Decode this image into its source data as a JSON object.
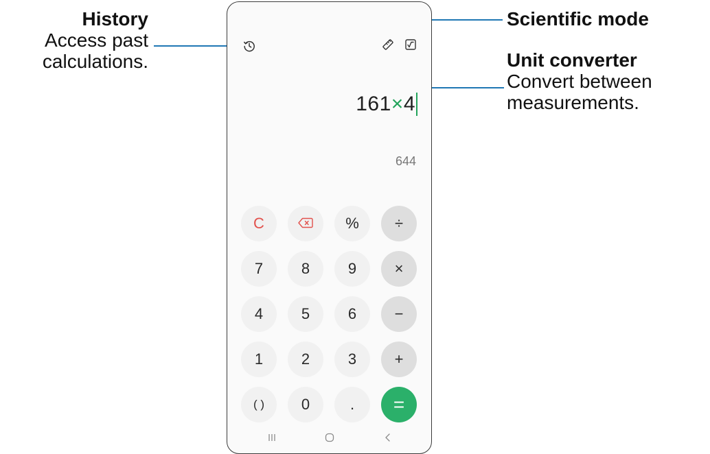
{
  "callouts": {
    "history_title": "History",
    "history_line1": "Access past",
    "history_line2": "calculations.",
    "scientific_title": "Scientific mode",
    "unit_title": "Unit converter",
    "unit_line1": "Convert between",
    "unit_line2": "measurements."
  },
  "display": {
    "expr_a": "161",
    "expr_op": "×",
    "expr_b": "4",
    "result": "644"
  },
  "keys": {
    "clear": "C",
    "percent": "%",
    "divide": "÷",
    "seven": "7",
    "eight": "8",
    "nine": "9",
    "multiply": "×",
    "four": "4",
    "five": "5",
    "six": "6",
    "minus": "−",
    "one": "1",
    "two": "2",
    "three": "3",
    "plus": "+",
    "parens": "( )",
    "zero": "0",
    "dot": ".",
    "equals": "="
  },
  "icons": {
    "history": "history-icon",
    "unit_converter": "ruler-icon",
    "scientific": "square-root-icon",
    "backspace": "backspace-icon"
  },
  "colors": {
    "accent": "#2bb06a",
    "clear": "#e2514c",
    "leader": "#1f77b4"
  }
}
